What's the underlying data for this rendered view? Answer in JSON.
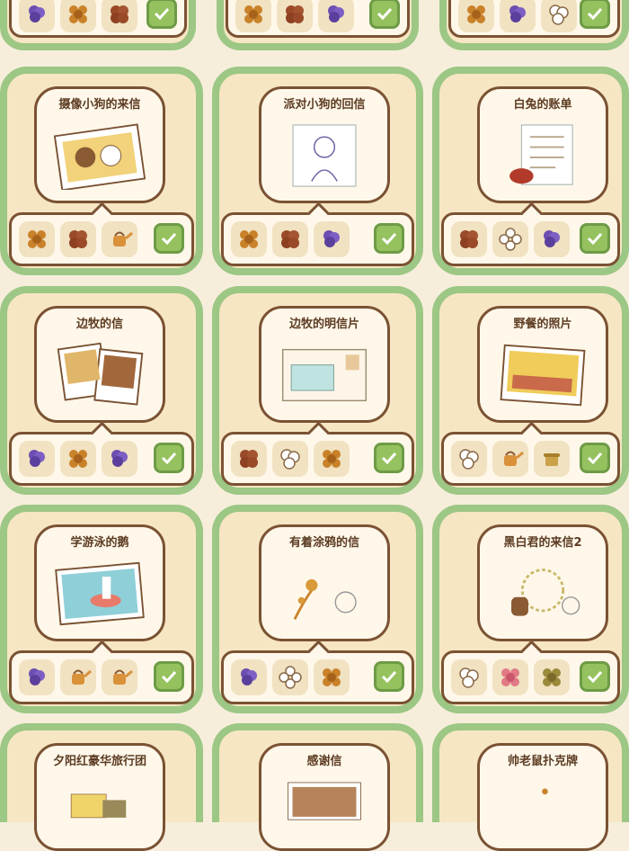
{
  "top_rows": [
    {
      "items": [
        "purple-flower-icon",
        "orange-flower-icon",
        "brown-seed-icon"
      ]
    },
    {
      "items": [
        "orange-flower-icon",
        "brown-seed-icon",
        "purple-flower-icon"
      ]
    },
    {
      "items": [
        "orange-flower-icon",
        "purple-flower-icon",
        "white-bubble-icon"
      ]
    }
  ],
  "cards": [
    {
      "title": "摄像小狗的来信",
      "items": [
        "orange-flower-icon",
        "brown-seed-icon",
        "watering-can-icon"
      ]
    },
    {
      "title": "派对小狗的回信",
      "items": [
        "orange-flower-icon",
        "brown-seed-icon",
        "purple-flower-icon"
      ]
    },
    {
      "title": "白兔的账单",
      "items": [
        "brown-seed-icon",
        "white-clover-icon",
        "purple-flower-icon"
      ]
    },
    {
      "title": "边牧的信",
      "items": [
        "purple-flower-icon",
        "orange-flower-icon",
        "purple-flower-icon"
      ]
    },
    {
      "title": "边牧的明信片",
      "items": [
        "brown-seed-icon",
        "white-bubble-icon",
        "orange-flower-icon"
      ]
    },
    {
      "title": "野餐的照片",
      "items": [
        "white-bubble-icon",
        "watering-can-icon",
        "pot-icon"
      ]
    },
    {
      "title": "学游泳的鹅",
      "items": [
        "purple-flower-icon",
        "watering-can-icon",
        "watering-can-icon"
      ]
    },
    {
      "title": "有着涂鸦的信",
      "items": [
        "purple-flower-icon",
        "white-clover-icon",
        "orange-flower-icon"
      ]
    },
    {
      "title": "黑白君的来信2",
      "items": [
        "white-bubble-icon",
        "pink-flower-icon",
        "olive-flower-icon"
      ]
    },
    {
      "title": "夕阳红豪华旅行团",
      "items": []
    },
    {
      "title": "感谢信",
      "items": []
    },
    {
      "title": "帅老鼠扑克牌",
      "items": []
    }
  ],
  "colors": {
    "card_border": "#9cc784",
    "card_bg": "#f7e6c3",
    "panel_border": "#7a5233",
    "check_bg": "#95c25f"
  }
}
